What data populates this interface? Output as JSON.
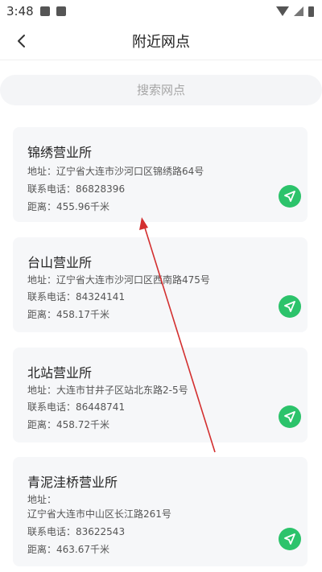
{
  "status_bar": {
    "time": "3:48"
  },
  "header": {
    "title": "附近网点"
  },
  "search": {
    "placeholder": "搜索网点"
  },
  "colors": {
    "accent": "#2cc36b",
    "card_bg": "#f6f7f9",
    "annotation": "#d32f2f"
  },
  "icons": {
    "back": "chevron-left-icon",
    "navigate": "navigation-arrow-icon"
  },
  "outlets": [
    {
      "name": "锦绣营业所",
      "address": "地址：辽宁省大连市沙河口区锦绣路64号",
      "phone": "联系电话：86828396",
      "distance": "距离：455.96千米"
    },
    {
      "name": "台山营业所",
      "address": "地址：辽宁省大连市沙河口区西南路475号",
      "phone": "联系电话：84324141",
      "distance": "距离：458.17千米"
    },
    {
      "name": "北站营业所",
      "address": "地址：大连市甘井子区站北东路2-5号",
      "phone": "联系电话：86448741",
      "distance": "距离：458.72千米"
    },
    {
      "name": "青泥洼桥营业所",
      "address_label": "地址：",
      "address": "辽宁省大连市中山区长江路261号",
      "phone": "联系电话：83622543",
      "distance": "距离：463.67千米"
    }
  ]
}
